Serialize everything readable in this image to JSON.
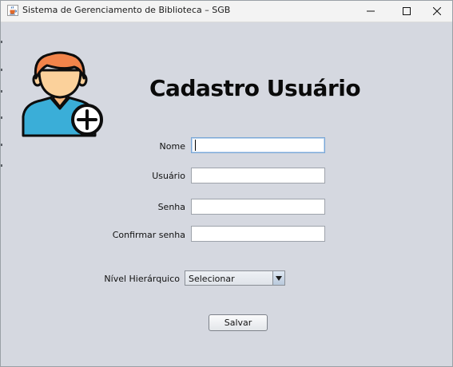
{
  "window": {
    "title": "Sistema de Gerenciamento de Biblioteca – SGB"
  },
  "form": {
    "heading": "Cadastro Usuário",
    "fields": {
      "nome": {
        "label": "Nome",
        "value": ""
      },
      "usuario": {
        "label": "Usuário",
        "value": ""
      },
      "senha": {
        "label": "Senha",
        "value": ""
      },
      "confirmar": {
        "label": "Confirmar senha",
        "value": ""
      }
    },
    "nivel": {
      "label": "Nível Hierárquico",
      "selected": "Selecionar"
    },
    "save_label": "Salvar"
  },
  "icons": {
    "app": "java-cup-icon",
    "avatar": "add-user-icon",
    "minimize": "minimize-icon",
    "maximize": "maximize-icon",
    "close": "close-icon",
    "dropdown": "chevron-down-icon"
  },
  "colors": {
    "background": "#d5d8e0",
    "titlebar": "#f3f3f3",
    "avatar_hair": "#f2844a",
    "avatar_skin": "#fbd19b",
    "avatar_shirt": "#3aaed8"
  }
}
